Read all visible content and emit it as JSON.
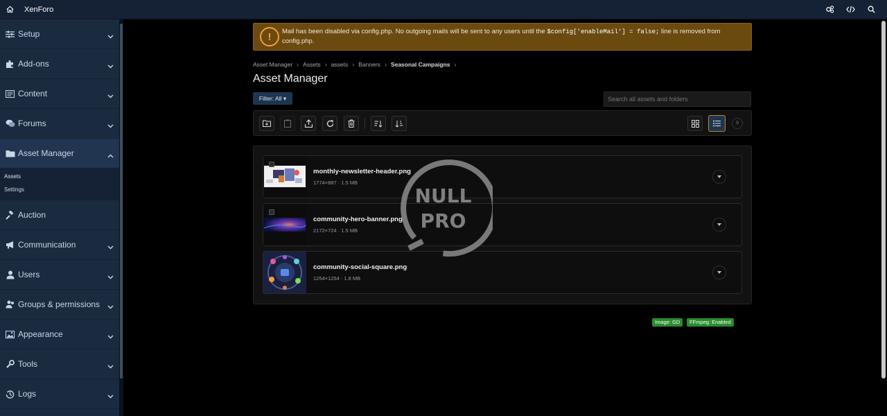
{
  "topbar": {
    "brand": "XenForo"
  },
  "sidebar": {
    "sections": [
      {
        "label": "Setup"
      },
      {
        "label": "Add-ons"
      },
      {
        "label": "Content"
      },
      {
        "label": "Forums"
      },
      {
        "label": "Asset Manager"
      },
      {
        "label": "Auction"
      },
      {
        "label": "Communication"
      },
      {
        "label": "Users"
      },
      {
        "label": "Groups & permissions"
      },
      {
        "label": "Appearance"
      },
      {
        "label": "Tools"
      },
      {
        "label": "Logs"
      }
    ],
    "asset_sub": [
      "Assets",
      "Settings"
    ]
  },
  "alert": {
    "text_before": "Mail has been disabled via config.php. No outgoing mails will be sent to any users until the ",
    "code": "$config['enableMail'] = false;",
    "text_after": " line is removed from config.php."
  },
  "breadcrumb": [
    "Asset Manager",
    "Assets",
    "assets",
    "Banners",
    "Seasonal Campaigns"
  ],
  "page_title": "Asset Manager",
  "filter_label": "Filter: All ▾",
  "search": {
    "placeholder": "Search all assets and folders"
  },
  "toolbar": {
    "count": "0"
  },
  "files": [
    {
      "name": "monthly-newsletter-header.png",
      "meta": "1774×887 · 1.5 MB"
    },
    {
      "name": "community-hero-banner.png",
      "meta": "2172×724 · 1.5 MB"
    },
    {
      "name": "community-social-square.png",
      "meta": "1254×1254 · 1.8 MB"
    }
  ],
  "badges": [
    "Image: GD",
    "FFmpeg: Enabled"
  ],
  "watermark": [
    "NULL",
    "PRO"
  ],
  "colors": {
    "accent": "#1e3550",
    "warning": "#6b4a10",
    "badge": "#2a8c2a"
  }
}
